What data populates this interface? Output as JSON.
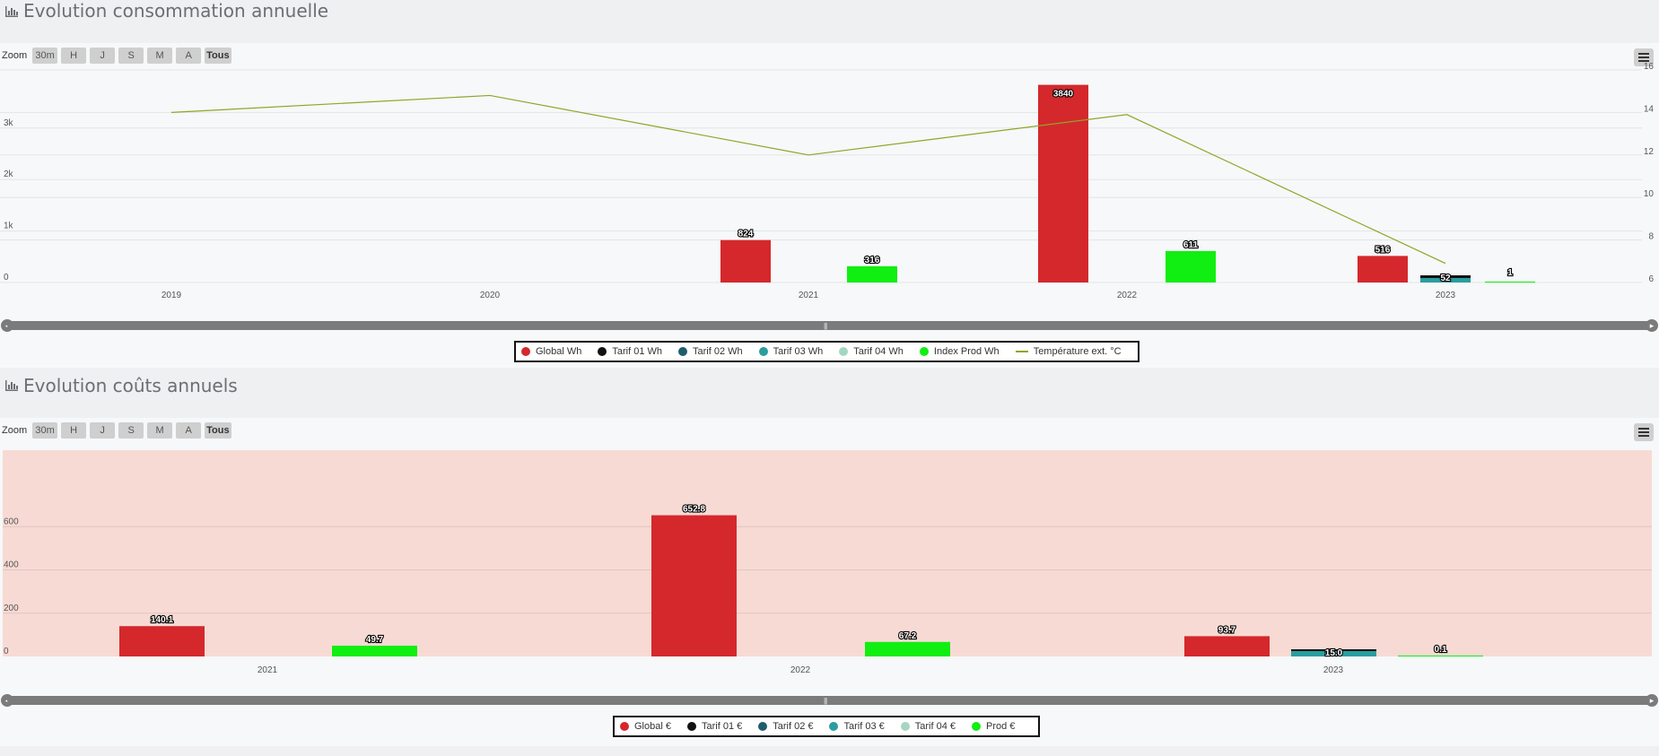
{
  "zoom": {
    "label": "Zoom",
    "buttons": [
      "30m",
      "H",
      "J",
      "S",
      "M",
      "A",
      "Tous"
    ],
    "active": "Tous"
  },
  "consumption": {
    "title": "Evolution consommation annuelle",
    "chart_data": {
      "type": "bar",
      "categories": [
        "2019",
        "2020",
        "2021",
        "2022",
        "2023"
      ],
      "y_ticks": [
        "0",
        "1k",
        "2k",
        "3k"
      ],
      "ylim": [
        0,
        4000
      ],
      "y2_ticks": [
        "6",
        "8",
        "10",
        "12",
        "14",
        "16"
      ],
      "y2lim": [
        6,
        16
      ],
      "series": [
        {
          "name": "Global Wh",
          "color": "#d4282c",
          "values": [
            null,
            null,
            824,
            3840,
            516
          ],
          "labels": [
            "",
            "",
            "824",
            "3840",
            "516"
          ]
        },
        {
          "name": "Tarif 01 Wh",
          "color": "#111111",
          "values": [
            null,
            null,
            null,
            null,
            52
          ],
          "labels": [
            "",
            "",
            "",
            "",
            "52"
          ]
        },
        {
          "name": "Tarif 02 Wh",
          "color": "#1f5d6b",
          "values": [
            null,
            null,
            null,
            null,
            null
          ],
          "labels": [
            "",
            "",
            "",
            "",
            ""
          ]
        },
        {
          "name": "Tarif 03 Wh",
          "color": "#2a9d9f",
          "values": [
            null,
            null,
            null,
            null,
            null
          ],
          "labels": [
            "",
            "",
            "",
            "",
            ""
          ]
        },
        {
          "name": "Tarif 04 Wh",
          "color": "#a5d6c2",
          "values": [
            null,
            null,
            null,
            null,
            null
          ],
          "labels": [
            "",
            "",
            "",
            "",
            ""
          ]
        },
        {
          "name": "Index Prod Wh",
          "color": "#11ee11",
          "values": [
            null,
            null,
            316,
            611,
            1
          ],
          "labels": [
            "",
            "",
            "316",
            "611",
            "1"
          ]
        }
      ],
      "line": {
        "name": "Température ext. °C",
        "color": "#8ea626",
        "values": [
          14.0,
          14.8,
          12.0,
          13.9,
          6.9
        ]
      }
    }
  },
  "costs": {
    "title": "Evolution coûts annuels",
    "chart_data": {
      "type": "bar",
      "categories": [
        "2021",
        "2022",
        "2023"
      ],
      "y_ticks": [
        "0",
        "200",
        "400",
        "600"
      ],
      "ylim": [
        0,
        800
      ],
      "plot_background": "#f8dad4",
      "series": [
        {
          "name": "Global €",
          "color": "#d4282c",
          "values": [
            140.1,
            652.8,
            93.7
          ],
          "labels": [
            "140.1",
            "652.8",
            "93.7"
          ]
        },
        {
          "name": "Tarif 01 €",
          "color": "#111111",
          "values": [
            null,
            null,
            15.0
          ],
          "labels": [
            "",
            "",
            "15.0"
          ]
        },
        {
          "name": "Tarif 02 €",
          "color": "#1f5d6b",
          "values": [
            null,
            null,
            null
          ],
          "labels": [
            "",
            "",
            ""
          ]
        },
        {
          "name": "Tarif 03 €",
          "color": "#2a9d9f",
          "values": [
            null,
            null,
            null
          ],
          "labels": [
            "",
            "",
            ""
          ]
        },
        {
          "name": "Tarif 04 €",
          "color": "#a5d6c2",
          "values": [
            null,
            null,
            null
          ],
          "labels": [
            "",
            "",
            ""
          ]
        },
        {
          "name": "Prod €",
          "color": "#11ee11",
          "values": [
            49.7,
            67.2,
            0.1
          ],
          "labels": [
            "49.7",
            "67.2",
            "0.1"
          ]
        }
      ]
    }
  }
}
